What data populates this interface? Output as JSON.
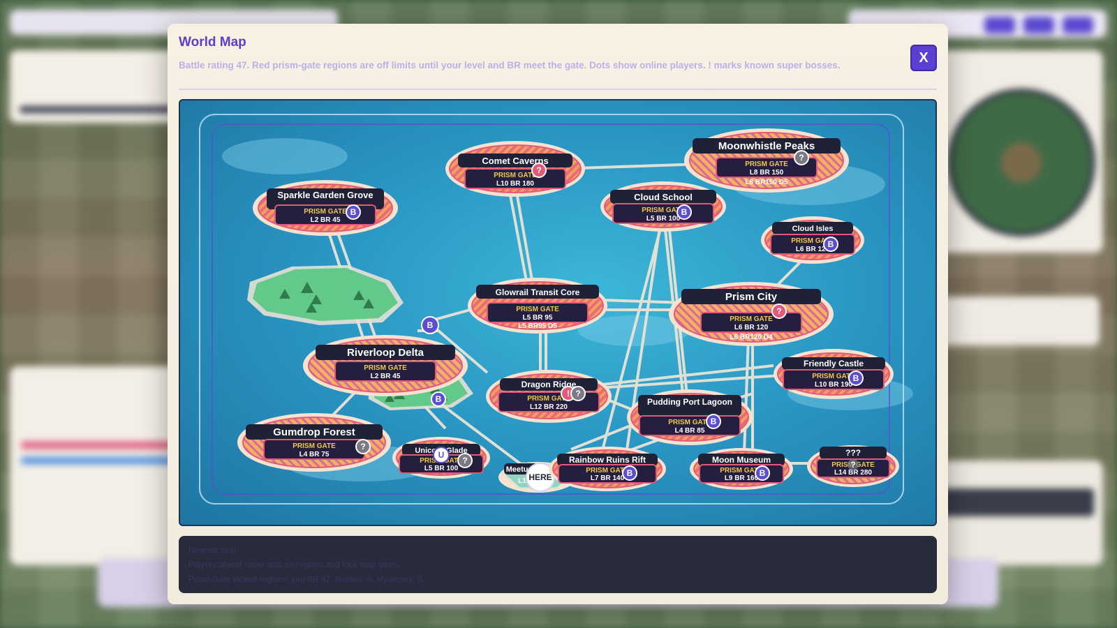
{
  "modal": {
    "title": "World Map",
    "subtitle": "Battle rating 47. Red prism-gate regions are off limits until your level and BR meet the gate. Dots show online players. ! marks known super bosses.",
    "close_label": "X"
  },
  "map": {
    "gate_label": "PRISM GATE",
    "here_label": "HERE",
    "colors": {
      "ocean": "#2a97c4",
      "gate_border": "#e25a7a",
      "label_bg": "#1f2236",
      "gate_text": "#f0c84a",
      "dot_b": "#5b4fd0",
      "dot_q": "#e25a7a",
      "dot_grey": "#7a7a86",
      "dot_u": "#ffffff"
    },
    "regions": [
      {
        "name": "Comet Caverns",
        "gate_text": "PRISM GATE",
        "level": "L10  BR 180",
        "markers": [
          "?"
        ]
      },
      {
        "name": "Moonwhistle Peaks",
        "gate_text": "PRISM GATE",
        "level": "L8  BR 150",
        "under": "L8 BR150 D5",
        "markers": [
          "?"
        ]
      },
      {
        "name": "Sparkle Garden Grove",
        "gate_text": "PRISM GATE",
        "level": "L2  BR 45",
        "markers": [
          "B"
        ]
      },
      {
        "name": "Cloud School",
        "gate_text": "PRISM GATE",
        "level": "L5  BR 100",
        "markers": [
          "B"
        ]
      },
      {
        "name": "Cloud Isles",
        "gate_text": "PRISM GATE",
        "level": "L6  BR 120",
        "markers": [
          "B"
        ]
      },
      {
        "name": "Glowrail Transit Core",
        "gate_text": "PRISM GATE",
        "level": "L5  BR 95",
        "under": "L5 BR95 D5",
        "markers": []
      },
      {
        "name": "Prism City",
        "gate_text": "PRISM GATE",
        "level": "L6  BR 120",
        "under": "L6 BR120 D4",
        "markers": [
          "?"
        ]
      },
      {
        "name": "Riverloop Delta",
        "gate_text": "PRISM GATE",
        "level": "L2  BR 45",
        "markers": [
          "B"
        ]
      },
      {
        "name": "Dragon Ridge",
        "gate_text": "PRISM GATE",
        "level": "L12  BR 220",
        "markers": [
          "!",
          "?"
        ]
      },
      {
        "name": "Friendly Castle",
        "gate_text": "PRISM GATE",
        "level": "L10  BR 190",
        "markers": [
          "B"
        ]
      },
      {
        "name": "Pudding Port Lagoon",
        "gate_text": "PRISM GATE",
        "level": "L4  BR 85",
        "markers": [
          "B"
        ]
      },
      {
        "name": "Gumdrop Forest",
        "gate_text": "PRISM GATE",
        "level": "L4  BR 75",
        "markers": [
          "?"
        ]
      },
      {
        "name": "Unicorn Glade",
        "gate_text": "PRISM GATE",
        "level": "L5  BR 100",
        "markers": [
          "U",
          "?"
        ]
      },
      {
        "name": "Meetup",
        "gate_text": "",
        "level": "L1",
        "markers": [
          "HERE"
        ]
      },
      {
        "name": "Rainbow Ruins Rift",
        "gate_text": "PRISM GATE",
        "level": "L7  BR 140",
        "markers": [
          "B"
        ]
      },
      {
        "name": "Moon Museum",
        "gate_text": "PRISM GATE",
        "level": "L9  BR 160",
        "markers": [
          "B"
        ]
      },
      {
        "name": "???",
        "gate_text": "PRISM GATE",
        "level": "L14  BR 280",
        "markers": [
          "?"
        ]
      }
    ],
    "free_markers": [
      "B"
    ]
  },
  "info": {
    "line1": "Nearest stop",
    "line2": "Players ahead show dots on regions and lock map gates.",
    "line3": "Prism Gate locked regions: you BR 47. Bosses: 0. Mysteries: 0."
  }
}
